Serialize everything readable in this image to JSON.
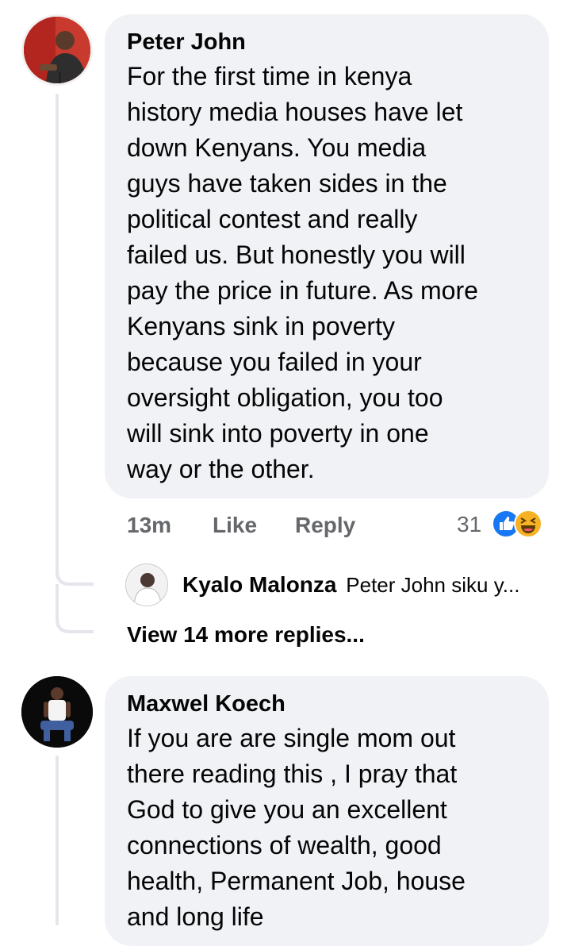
{
  "comments": [
    {
      "author": "Peter John",
      "text": "For the first time in kenya\nhistory media houses have let\ndown Kenyans. You media\nguys have taken sides in the\npolitical contest and really\nfailed us. But honestly you will\npay the price in future. As more\nKenyans sink in poverty\nbecause you failed in your\noversight obligation, you too\nwill sink  into poverty in one\nway or the other.",
      "time": "13m",
      "like_label": "Like",
      "reply_label": "Reply",
      "reaction_count": "31",
      "reactions": [
        "like-icon",
        "haha-icon"
      ],
      "reply_preview": {
        "author": "Kyalo Malonza",
        "text": "Peter John siku y..."
      },
      "view_more": "View 14 more replies..."
    },
    {
      "author": "Maxwel Koech",
      "text": "If you are are single mom out\nthere reading this , I pray that\nGod to give you an excellent\nconnections of wealth, good\nhealth, Permanent Job, house\nand long life"
    }
  ],
  "colors": {
    "bubble": "#f0f2f5",
    "meta": "#65676b",
    "like_blue": "#1877f2",
    "haha_yellow": "#f7b125"
  }
}
